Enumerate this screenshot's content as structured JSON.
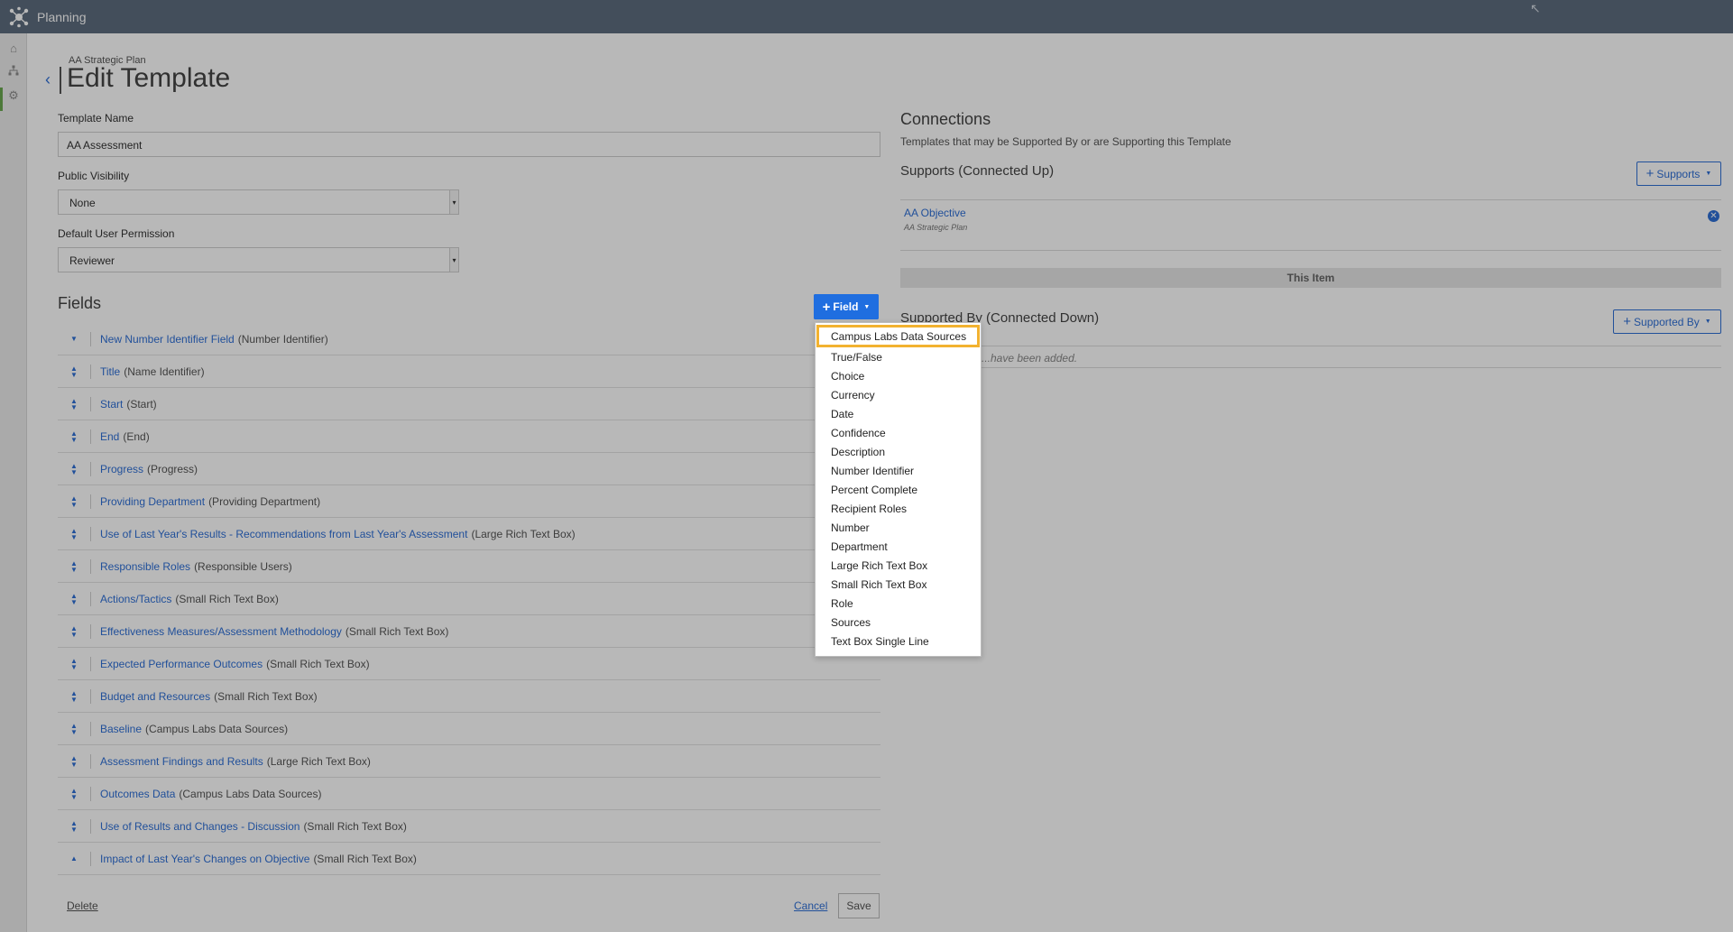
{
  "app": {
    "title": "Planning"
  },
  "rail": {
    "icons": [
      "home-icon",
      "hierarchy-icon",
      "gear-icon"
    ]
  },
  "header": {
    "breadcrumb": "AA Strategic Plan",
    "title": "Edit Template",
    "back_icon": "chevron-left-icon"
  },
  "form": {
    "template_name_label": "Template Name",
    "template_name_value": "AA Assessment",
    "public_visibility_label": "Public Visibility",
    "public_visibility_value": "None",
    "default_permission_label": "Default User Permission",
    "default_permission_value": "Reviewer"
  },
  "fields_section": {
    "title": "Fields",
    "add_button": "Field",
    "items": [
      {
        "name": "New Number Identifier Field",
        "type": "(Number Identifier)",
        "handle": "down"
      },
      {
        "name": "Title",
        "type": "(Name Identifier)",
        "handle": "both"
      },
      {
        "name": "Start",
        "type": "(Start)",
        "handle": "both"
      },
      {
        "name": "End",
        "type": "(End)",
        "handle": "both"
      },
      {
        "name": "Progress",
        "type": "(Progress)",
        "handle": "both"
      },
      {
        "name": "Providing Department",
        "type": "(Providing Department)",
        "handle": "both"
      },
      {
        "name": "Use of Last Year's Results - Recommendations from Last Year's Assessment",
        "type": "(Large Rich Text Box)",
        "handle": "both"
      },
      {
        "name": "Responsible Roles",
        "type": "(Responsible Users)",
        "handle": "both"
      },
      {
        "name": "Actions/Tactics",
        "type": "(Small Rich Text Box)",
        "handle": "both"
      },
      {
        "name": "Effectiveness Measures/Assessment Methodology",
        "type": "(Small Rich Text Box)",
        "handle": "both"
      },
      {
        "name": "Expected Performance Outcomes",
        "type": "(Small Rich Text Box)",
        "handle": "both"
      },
      {
        "name": "Budget and Resources",
        "type": "(Small Rich Text Box)",
        "handle": "both"
      },
      {
        "name": "Baseline",
        "type": "(Campus Labs Data Sources)",
        "handle": "both"
      },
      {
        "name": "Assessment Findings and Results",
        "type": "(Large Rich Text Box)",
        "handle": "both"
      },
      {
        "name": "Outcomes Data",
        "type": "(Campus Labs Data Sources)",
        "handle": "both"
      },
      {
        "name": "Use of Results and Changes - Discussion",
        "type": "(Small Rich Text Box)",
        "handle": "both"
      },
      {
        "name": "Impact of Last Year's Changes on Objective",
        "type": "(Small Rich Text Box)",
        "handle": "up"
      }
    ],
    "delete_label": "Delete",
    "cancel_label": "Cancel",
    "save_label": "Save"
  },
  "connections": {
    "title": "Connections",
    "subtitle": "Templates that may be Supported By or are Supporting this Template",
    "supports_title": "Supports (Connected Up)",
    "supports_button": "Supports",
    "supports_item_name": "AA Objective",
    "supports_item_sub": "AA Strategic Plan",
    "this_item": "This Item",
    "supported_by_title": "Supported By (Connected Down)",
    "supported_by_button": "Supported By",
    "supported_by_empty": "...have been added."
  },
  "dropdown": {
    "items": [
      "Campus Labs Data Sources",
      "True/False",
      "Choice",
      "Currency",
      "Date",
      "Confidence",
      "Description",
      "Number Identifier",
      "Percent Complete",
      "Recipient Roles",
      "Number",
      "Department",
      "Large Rich Text Box",
      "Small Rich Text Box",
      "Role",
      "Sources",
      "Text Box Single Line"
    ],
    "highlighted_index": 0,
    "highlight_color": "#f2b230"
  },
  "colors": {
    "topbar": "#5e6d7e",
    "link": "#2f6fd6",
    "primary_button": "#1f6ee0"
  }
}
